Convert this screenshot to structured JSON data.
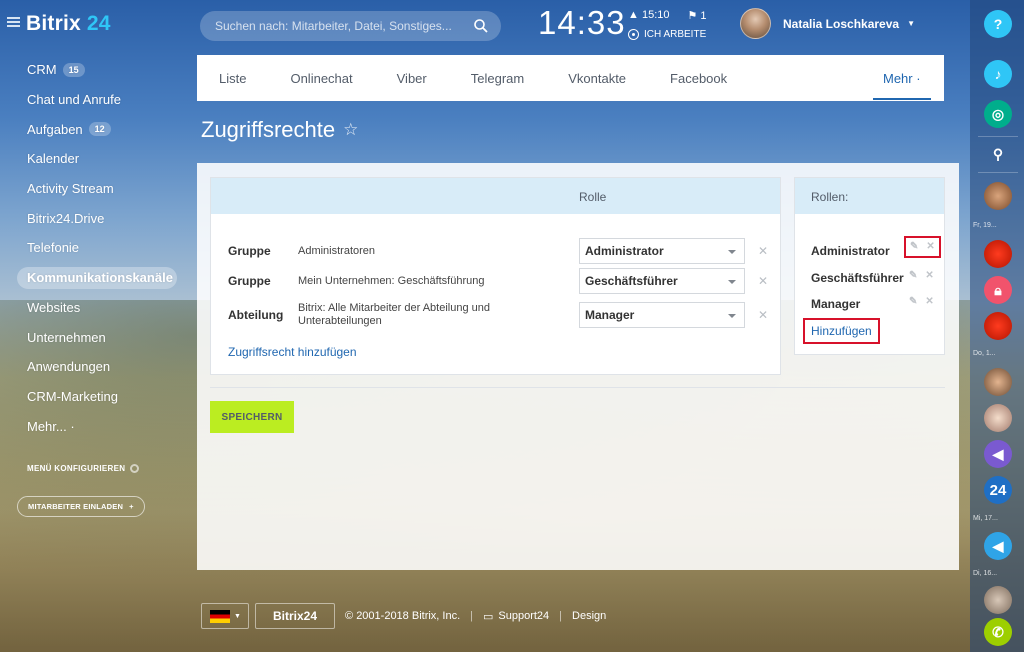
{
  "header": {
    "logo_text": "Bitrix",
    "logo_num": "24",
    "search_placeholder": "Suchen nach: Mitarbeiter, Datei, Sonstiges...",
    "clock": "14:33",
    "alarm_time": "15:10",
    "flag_count": "1",
    "work_status": "ICH ARBEITE",
    "user_name": "Natalia Loschkareva"
  },
  "sidebar": {
    "items": [
      {
        "label": "CRM",
        "count": "15"
      },
      {
        "label": "Chat und Anrufe"
      },
      {
        "label": "Aufgaben",
        "count": "12"
      },
      {
        "label": "Kalender"
      },
      {
        "label": "Activity Stream"
      },
      {
        "label": "Bitrix24.Drive"
      },
      {
        "label": "Telefonie"
      },
      {
        "label": "Kommunikationskanäle"
      },
      {
        "label": "Websites"
      },
      {
        "label": "Unternehmen"
      },
      {
        "label": "Anwendungen"
      },
      {
        "label": "CRM-Marketing"
      },
      {
        "label": "Mehr... ·"
      }
    ],
    "configure_label": "MENÜ KONFIGURIEREN",
    "invite_label": "MITARBEITER EINLADEN"
  },
  "tabs": [
    "Liste",
    "Onlinechat",
    "Viber",
    "Telegram",
    "Vkontakte",
    "Facebook"
  ],
  "more_tab": "Mehr ·",
  "page_title": "Zugriffsrechte",
  "access_table": {
    "role_header": "Rolle",
    "rows": [
      {
        "type": "Gruppe",
        "name": "Administratoren",
        "role": "Administrator"
      },
      {
        "type": "Gruppe",
        "name": "Mein Unternehmen: Geschäftsführung",
        "role": "Geschäftsführer"
      },
      {
        "type": "Abteilung",
        "name": "Bitrix: Alle Mitarbeiter der Abteilung und Unterabteilungen",
        "role": "Manager"
      }
    ],
    "add_link": "Zugriffsrecht hinzufügen"
  },
  "roles_panel": {
    "header": "Rollen:",
    "roles": [
      "Administrator",
      "Geschäftsführer",
      "Manager"
    ],
    "add_label": "Hinzufügen"
  },
  "save_label": "SPEICHERN",
  "footer": {
    "brand": "Bitrix24",
    "copyright": "© 2001-2018 Bitrix, Inc.",
    "support": "Support24",
    "design": "Design"
  },
  "rightbar": {
    "dates": [
      "Fr, 19...",
      "Do, 1...",
      "Mi, 17...",
      "Di, 16..."
    ],
    "badge_24": "24"
  },
  "colors": {
    "accent_blue": "#2067b0",
    "save_green": "#bbed21",
    "highlight_red": "#d7112a",
    "header_row": "#d8ecf8"
  }
}
